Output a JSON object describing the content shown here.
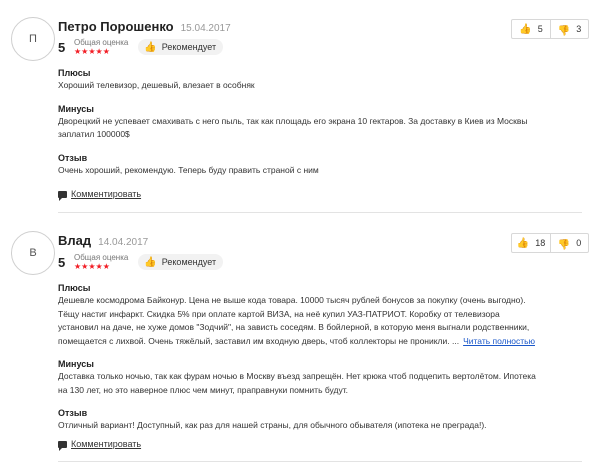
{
  "reviews": [
    {
      "avatar_letter": "П",
      "author": "Петро Порошенко",
      "date": "15.04.2017",
      "rating": "5",
      "rating_label": "Общая оценка",
      "stars": "★★★★★",
      "recommend": "Рекомендует",
      "likes": "5",
      "dislikes": "3",
      "pros_title": "Плюсы",
      "pros": "Хороший телевизор, дешевый, влезает в особняк",
      "cons_title": "Минусы",
      "cons": "Дворецкий не успевает смахивать с него пыль, так как площадь его экрана 10 гектаров. За доставку в Киев из Москвы заплатил 100000$",
      "comment_title": "Отзыв",
      "comment": "Очень хороший, рекомендую. Теперь буду править страной с ним",
      "comment_link": "Комментировать"
    },
    {
      "avatar_letter": "В",
      "author": "Влад",
      "date": "14.04.2017",
      "rating": "5",
      "rating_label": "Общая оценка",
      "stars": "★★★★★",
      "recommend": "Рекомендует",
      "likes": "18",
      "dislikes": "0",
      "pros_title": "Плюсы",
      "pros": "Дешевле космодрома Байконур. Цена не выше кода товара. 10000 тысяч рублей бонусов за покупку (очень выгодно). Тёщу настиг инфаркт. Скидка 5% при оплате картой ВИЗА, на неё купил УАЗ-ПАТРИОТ. Коробку от телевизора установил на даче, не хуже домов \"Зодчий\", на зависть соседям. В бойлерной, в которую меня выгнали родственники, помещается с лихвой. Очень тяжёлый, заставил им входную дверь, чтоб коллекторы не проникли. ...",
      "read_more": "Читать полностью",
      "cons_title": "Минусы",
      "cons": "Доставка только ночью, так как фурам ночью в Москву въезд запрещён. Нет крюка чтоб подцепить вертолётом. Ипотека на 130 лет, но это наверное плюс чем минут, праправнуки помнить будут.",
      "comment_title": "Отзыв",
      "comment": "Отличный вариант! Доступный, как раз для нашей страны, для обычного обывателя (ипотека не преграда!).",
      "comment_link": "Комментировать"
    }
  ],
  "colors": {
    "stars": "#f21c24",
    "recommend_icon": "#36a64f",
    "link": "#1a57c9"
  },
  "icons": {
    "recommend": "thumbs-up-icon",
    "like": "thumbs-up-icon",
    "dislike": "thumbs-down-icon",
    "comment": "speech-bubble-icon"
  }
}
